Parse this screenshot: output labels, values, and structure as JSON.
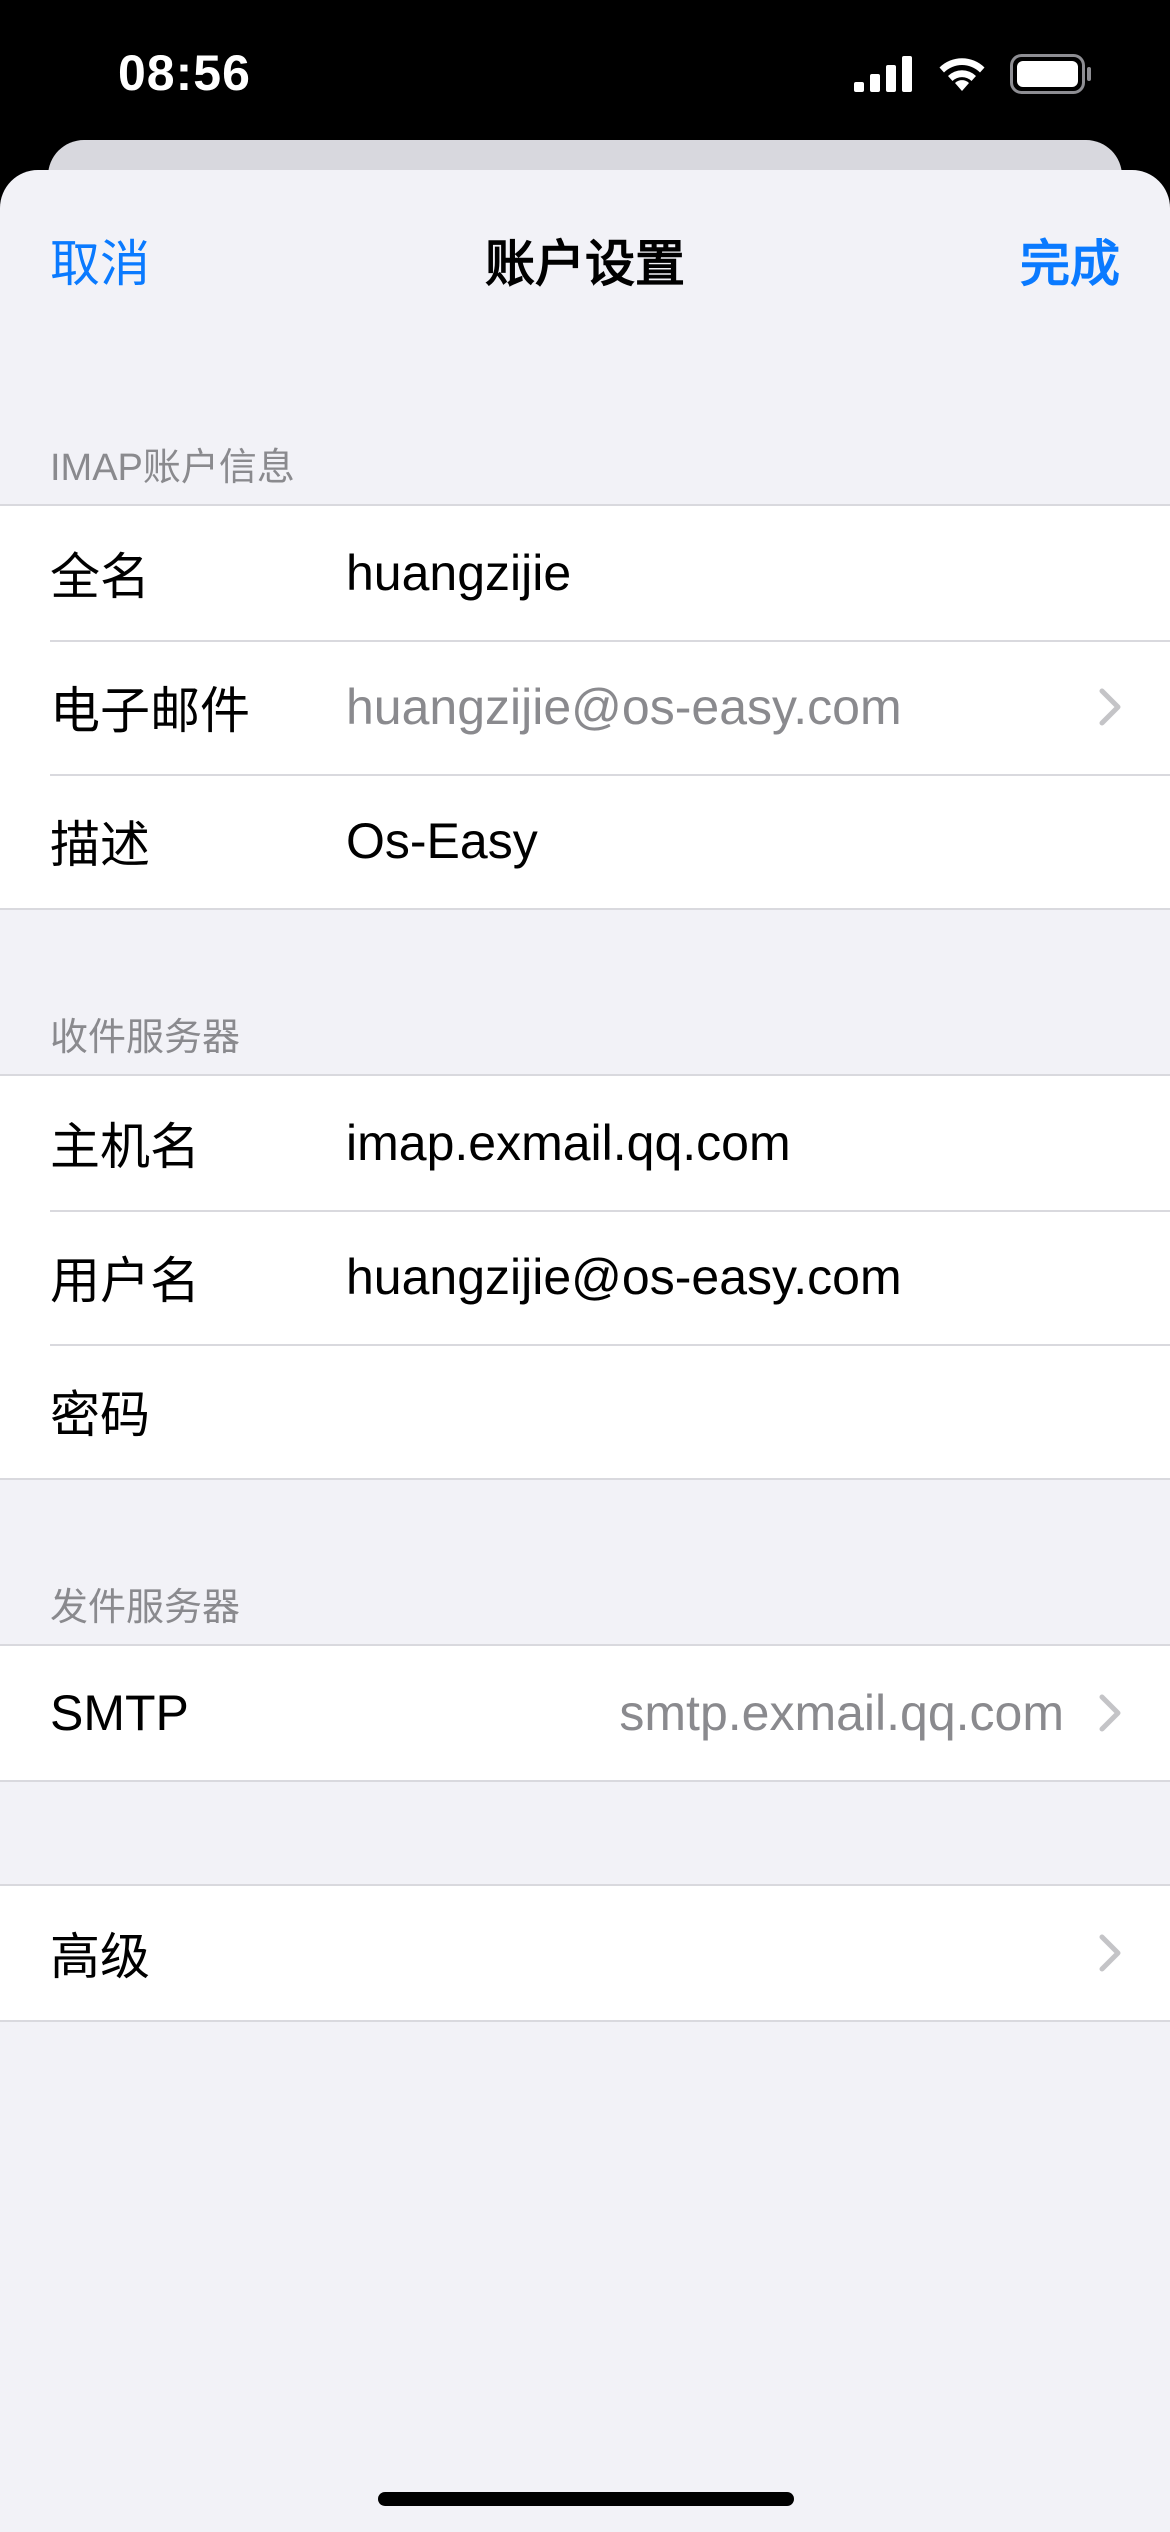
{
  "status_bar": {
    "time": "08:56",
    "icons": [
      "cellular-signal-icon",
      "wifi-icon",
      "battery-icon"
    ]
  },
  "nav": {
    "cancel_label": "取消",
    "title": "账户设置",
    "done_label": "完成"
  },
  "imap_section": {
    "header": "IMAP账户信息",
    "rows": [
      {
        "label": "全名",
        "value": "huangzijie"
      },
      {
        "label": "电子邮件",
        "value": "huangzijie@os-easy.com"
      },
      {
        "label": "描述",
        "value": "Os-Easy"
      }
    ]
  },
  "incoming_section": {
    "header": "收件服务器",
    "rows": [
      {
        "label": "主机名",
        "value": "imap.exmail.qq.com"
      },
      {
        "label": "用户名",
        "value": "huangzijie@os-easy.com"
      },
      {
        "label": "密码",
        "value": ""
      }
    ]
  },
  "outgoing_section": {
    "header": "发件服务器",
    "rows": [
      {
        "label": "SMTP",
        "value": "smtp.exmail.qq.com"
      }
    ]
  },
  "advanced_section": {
    "rows": [
      {
        "label": "高级"
      }
    ]
  },
  "colors": {
    "accent": "#0a7aff",
    "background": "#f2f2f7",
    "secondary_text": "#8a8a8e",
    "separator": "#d9d9de"
  }
}
